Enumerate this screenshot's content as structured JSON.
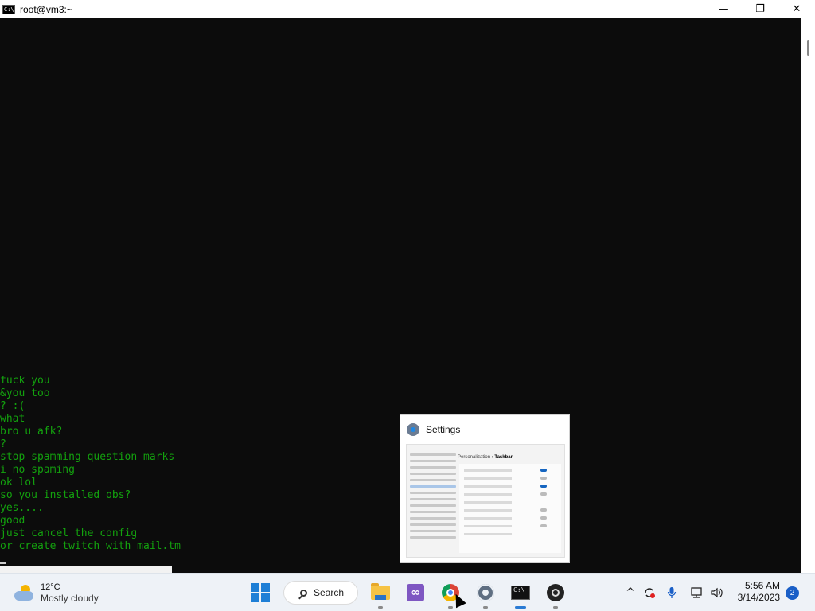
{
  "window": {
    "title": "root@vm3:~",
    "app_icon": "console-icon",
    "controls": [
      "minimize-icon",
      "restore-icon",
      "close-icon"
    ],
    "minimize_glyph": "—",
    "restore_glyph": "❐",
    "close_glyph": "✕"
  },
  "console": {
    "text_color": "#13a10e",
    "background": "#0c0c0c",
    "lines": [
      "fuck you",
      "&you too",
      "? :(",
      "what",
      "bro u afk?",
      "?",
      "stop spamming question marks",
      "i no spaming",
      "ok lol",
      "so you installed obs?",
      "yes....",
      "good",
      "just cancel the config",
      "or create twitch with mail.tm"
    ]
  },
  "preview": {
    "title": "Settings",
    "icon": "settings-icon",
    "content": {
      "breadcrumb_section": "Personalization",
      "breadcrumb_sep": "›",
      "breadcrumb_page": "Taskbar"
    }
  },
  "taskbar": {
    "weather": {
      "temperature": "12°C",
      "condition": "Mostly cloudy",
      "icon": "partly-cloudy-icon"
    },
    "search_label": "Search",
    "apps": [
      {
        "name": "File Explorer",
        "icon": "folder-icon"
      },
      {
        "name": "Visual Studio",
        "icon": "visual-studio-icon"
      },
      {
        "name": "Google Chrome",
        "icon": "chrome-icon"
      },
      {
        "name": "Settings",
        "icon": "settings-icon"
      },
      {
        "name": "Command Prompt",
        "icon": "terminal-icon",
        "active": true
      },
      {
        "name": "OBS Studio",
        "icon": "obs-icon"
      }
    ],
    "tray": {
      "chevron": "^",
      "icons": [
        "chevron-up-icon",
        "sync-icon",
        "microphone-icon",
        "network-icon",
        "volume-icon"
      ]
    },
    "clock": {
      "time": "5:56 AM",
      "date": "3/14/2023"
    },
    "notification_count": "2",
    "accent": "#1a5fc7"
  }
}
